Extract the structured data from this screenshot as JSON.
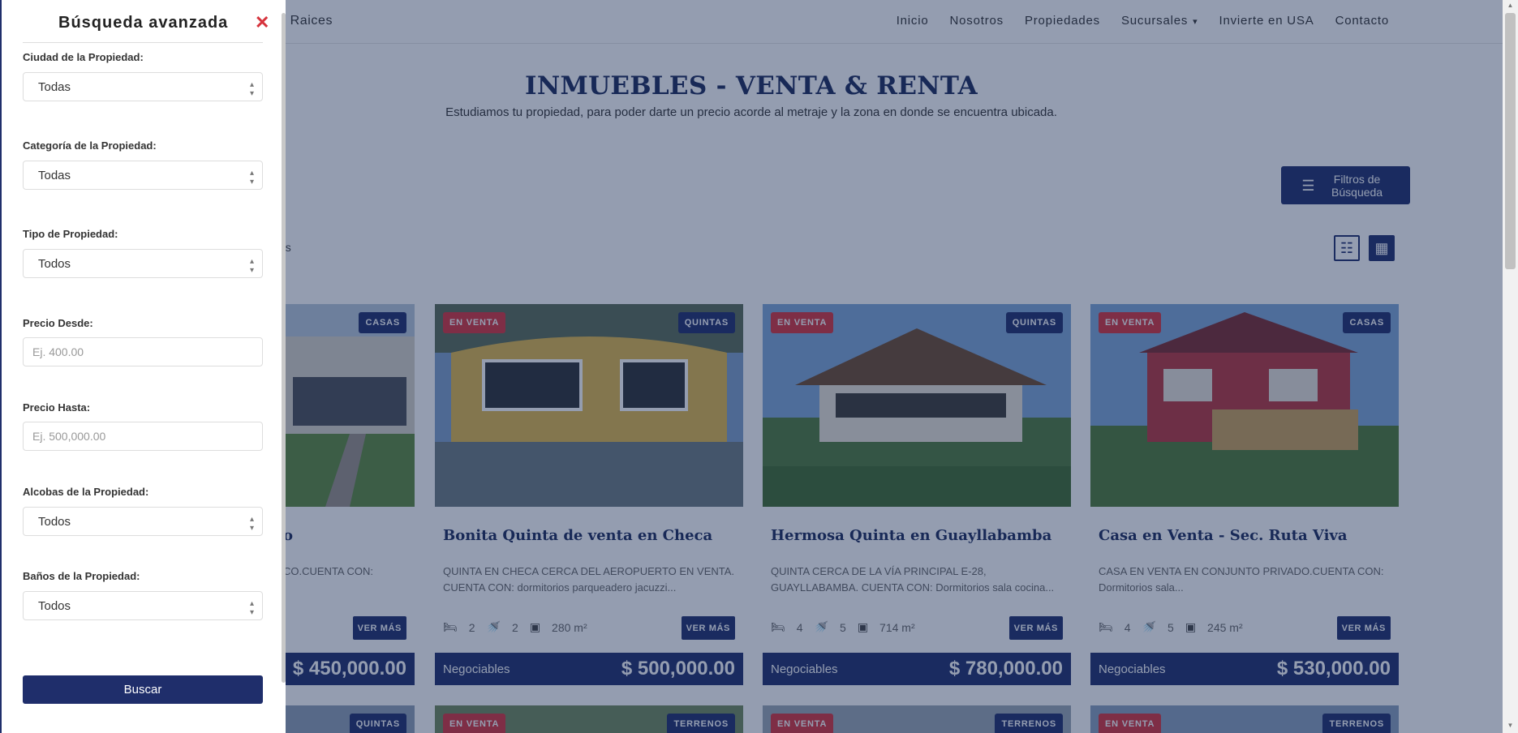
{
  "header": {
    "brand": "Bienes Raices",
    "nav": [
      "Inicio",
      "Nosotros",
      "Propiedades",
      "Sucursales",
      "Invierte en USA",
      "Contacto"
    ]
  },
  "hero": {
    "title": "INMUEBLES - VENTA & RENTA",
    "subtitle": "Estudiamos tu propiedad, para poder darte un precio acorde al metraje y la zona en donde se encuentra ubicada."
  },
  "filters_button": {
    "label": "Filtros de Búsqueda"
  },
  "results": {
    "text": "os"
  },
  "cards": [
    {
      "status": "",
      "category": "CASAS",
      "title": "o",
      "desc": "CO.CUENTA CON:",
      "beds": "",
      "baths": "",
      "area": "",
      "price_label": "",
      "price": "$ 450,000.00"
    },
    {
      "status": "EN VENTA",
      "category": "QUINTAS",
      "title": "Bonita Quinta de venta en Checa",
      "desc": "QUINTA EN CHECA CERCA DEL AEROPUERTO EN VENTA. CUENTA CON: dormitorios parqueadero jacuzzi...",
      "beds": "2",
      "baths": "2",
      "area": "280 m²",
      "price_label": "Negociables",
      "price": "$ 500,000.00"
    },
    {
      "status": "EN VENTA",
      "category": "QUINTAS",
      "title": "Hermosa Quinta en Guayllabamba",
      "desc": "QUINTA CERCA DE LA VÍA PRINCIPAL E-28, GUAYLLABAMBA. CUENTA CON: Dormitorios sala cocina...",
      "beds": "4",
      "baths": "5",
      "area": "714 m²",
      "price_label": "Negociables",
      "price": "$ 780,000.00"
    },
    {
      "status": "EN VENTA",
      "category": "CASAS",
      "title": "Casa en Venta - Sec. Ruta Viva",
      "desc": "CASA EN VENTA EN CONJUNTO PRIVADO.CUENTA CON: Dormitorios sala...",
      "beds": "4",
      "baths": "5",
      "area": "245 m²",
      "price_label": "Negociables",
      "price": "$ 530,000.00"
    }
  ],
  "ver_mas": "VER MÁS",
  "cards_row2": [
    {
      "status": "",
      "category": "QUINTAS"
    },
    {
      "status": "EN VENTA",
      "category": "TERRENOS"
    },
    {
      "status": "EN VENTA",
      "category": "TERRENOS"
    },
    {
      "status": "EN VENTA",
      "category": "TERRENOS"
    }
  ],
  "panel": {
    "title": "Búsqueda avanzada",
    "close": "✕",
    "ciudad": {
      "label": "Ciudad de la Propiedad:",
      "value": "Todas"
    },
    "categoria": {
      "label": "Categoría de la Propiedad:",
      "value": "Todas"
    },
    "tipo": {
      "label": "Tipo de Propiedad:",
      "value": "Todos"
    },
    "precio_desde": {
      "label": "Precio Desde:",
      "placeholder": "Ej.  400.00"
    },
    "precio_hasta": {
      "label": "Precio Hasta:",
      "placeholder": "Ej.  500,000.00"
    },
    "alcobas": {
      "label": "Alcobas de la Propiedad:",
      "value": "Todos"
    },
    "banos": {
      "label": "Baños de la Propiedad:",
      "value": "Todos"
    },
    "buscar": "Buscar"
  },
  "colors": {
    "primary": "#1f2e6b",
    "accent": "#d6333c",
    "overlay": "#162a52"
  },
  "icons": [
    "close-icon",
    "sliders-icon",
    "list-view-icon",
    "grid-view-icon",
    "bed-icon",
    "bath-icon",
    "area-icon",
    "chevron-down-icon"
  ]
}
